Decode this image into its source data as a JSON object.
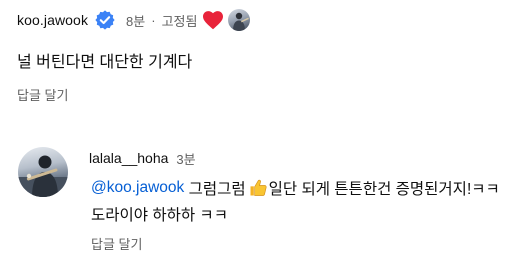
{
  "comment": {
    "author": "koo.jawook",
    "time": "8분",
    "separator": "·",
    "pinned_label": "고정됨",
    "text": "널 버틴다면 대단한 기계다",
    "reply_label": "답글 달기"
  },
  "reply": {
    "author": "lalala__hoha",
    "time": "3분",
    "mention": "@koo.jawook",
    "text_before_emoji": " 그럼그럼",
    "text_after_emoji": "일단 되게 튼튼한건 증명된거지!ㅋㅋ",
    "text_line2": "도라이야 하하하 ㅋㅋ",
    "reply_label": "답글 달기"
  },
  "colors": {
    "verified_badge": "#3b82f6",
    "heart": "#e8233a",
    "mention": "#065fd4",
    "meta_text": "#606060"
  },
  "icons": {
    "verified": "verified-check-icon",
    "heart": "heart-icon",
    "thumbs_up": "thumbs-up-emoji"
  }
}
